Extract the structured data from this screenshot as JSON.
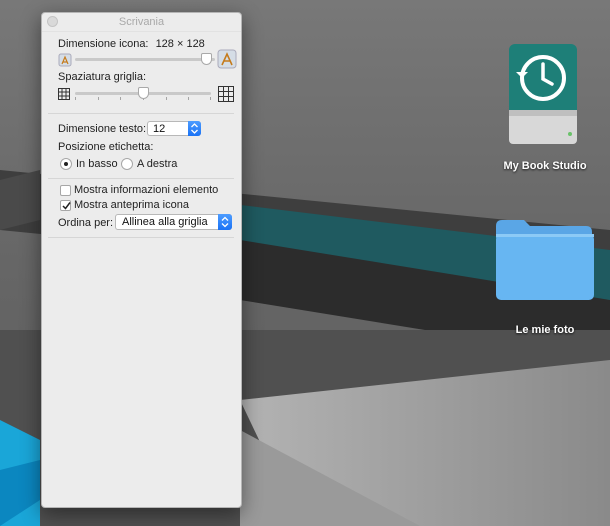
{
  "window": {
    "title": "Scrivania"
  },
  "icon_size": {
    "label": "Dimensione icona:",
    "value": "128 × 128",
    "slider_level": 1.0
  },
  "grid_spacing": {
    "label": "Spaziatura griglia:",
    "slider_level": 0.5
  },
  "text_size": {
    "label": "Dimensione testo:",
    "value": "12"
  },
  "label_position": {
    "label": "Posizione etichetta:",
    "options": [
      {
        "label": "In basso",
        "selected": true
      },
      {
        "label": "A destra",
        "selected": false
      }
    ]
  },
  "show_item_info": {
    "label": "Mostra informazioni elemento",
    "checked": false
  },
  "show_icon_preview": {
    "label": "Mostra anteprima icona",
    "checked": true
  },
  "sort_by": {
    "label": "Ordina per:",
    "value": "Allinea alla griglia"
  },
  "desktop_items": [
    {
      "label": "My Book Studio",
      "icon": "external-drive-time-machine-icon"
    },
    {
      "label": "Le mie foto",
      "icon": "folder-icon"
    }
  ],
  "colors": {
    "accent": "#1a72f5",
    "panel_bg": "#ececec",
    "drive_green": "#1e7f78",
    "folder_blue": "#67b6f2"
  }
}
